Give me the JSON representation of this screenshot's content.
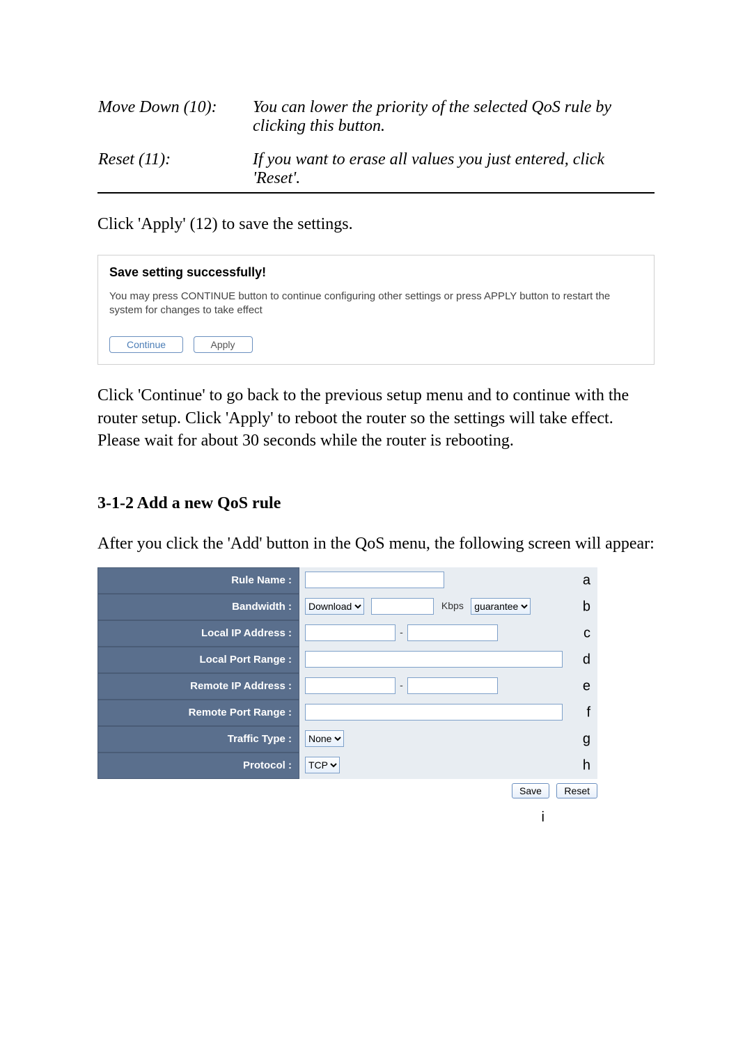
{
  "defs": {
    "move_down": {
      "term": "Move Down (10):",
      "desc": "You can lower the priority of the selected QoS rule by clicking this button."
    },
    "reset": {
      "term": "Reset (11):",
      "desc": "If you want to erase all values you just entered, click 'Reset'."
    }
  },
  "apply_hint": "Click 'Apply' (12) to save the settings.",
  "save_panel": {
    "title": "Save setting successfully!",
    "message": "You may press CONTINUE button to continue configuring other settings or press APPLY button to restart the system for changes to take effect",
    "continue": "Continue",
    "apply": "Apply"
  },
  "continue_para": "Click 'Continue' to go back to the previous setup menu and to continue with the router setup. Click 'Apply' to reboot the router so the settings will take effect. Please wait for about 30 seconds while the router is rebooting.",
  "section_title": "3-1-2 Add a new QoS rule",
  "section_intro": "After you click the 'Add' button in the QoS menu, the following screen will appear:",
  "form": {
    "rule_name_label": "Rule Name :",
    "bandwidth_label": "Bandwidth :",
    "local_ip_label": "Local IP Address :",
    "local_port_label": "Local Port Range :",
    "remote_ip_label": "Remote IP Address :",
    "remote_port_label": "Remote Port Range :",
    "traffic_type_label": "Traffic Type :",
    "protocol_label": "Protocol :",
    "bw_direction": "Download",
    "bw_unit": "Kbps",
    "bw_mode": "guarantee",
    "traffic_type_value": "None",
    "protocol_value": "TCP",
    "save_btn": "Save",
    "reset_btn": "Reset",
    "annot": {
      "a": "a",
      "b": "b",
      "c": "c",
      "d": "d",
      "e": "e",
      "f": "f",
      "g": "g",
      "h": "h",
      "i": "i"
    }
  }
}
